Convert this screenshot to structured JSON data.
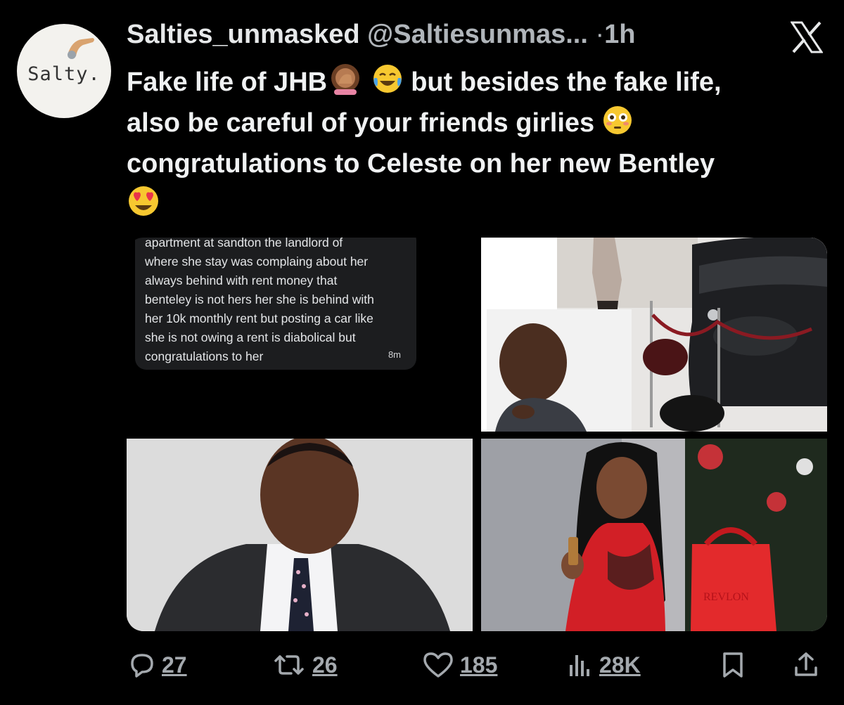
{
  "tweet": {
    "avatar_text": "Salty.",
    "display_name": "Salties_unmasked",
    "handle": "@Saltiesunmas...",
    "separator": "·",
    "time": "1h",
    "text_lines": [
      "Fake life of JHB",
      "but besides the fake life,",
      "also be careful of your friends girlies",
      "congratulations to Celeste on her new Bentley"
    ],
    "emojis": [
      "facepalm-emoji",
      "tears-of-joy-emoji",
      "flushed-emoji",
      "heart-eyes-emoji"
    ]
  },
  "media": {
    "screenshot": {
      "lines": [
        "apartment at sandton the landlord of",
        "where she stay was complaing about her",
        "always behind with rent money that",
        "benteley is not hers her she is behind with",
        "her 10k monthly rent but posting a car like",
        "she is not owing a rent is diabolical but",
        "congratulations to her"
      ],
      "time": "8m"
    },
    "product_text": "REVLON"
  },
  "actions": {
    "replies": "27",
    "reposts": "26",
    "likes": "185",
    "views": "28K"
  },
  "colors": {
    "background": "#000000",
    "text": "#e7e9ea",
    "muted": "#a4a9ae"
  }
}
